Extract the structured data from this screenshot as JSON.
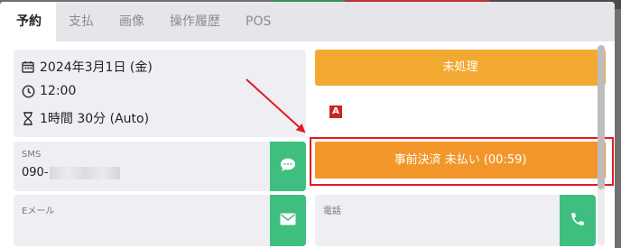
{
  "tabs": [
    {
      "label": "予約",
      "active": true
    },
    {
      "label": "支払"
    },
    {
      "label": "画像"
    },
    {
      "label": "操作履歴"
    },
    {
      "label": "POS"
    }
  ],
  "reservation": {
    "date": "2024年3月1日 (金)",
    "time": "12:00",
    "duration": "1時間 30分 (Auto)"
  },
  "sms": {
    "label": "SMS",
    "value": "090-"
  },
  "email": {
    "label": "Eメール"
  },
  "phone": {
    "label": "電話"
  },
  "status_button": {
    "label": "未処理",
    "color": "#f2a931"
  },
  "badge": {
    "letter": "A",
    "color": "#c62828"
  },
  "prepayment_button": {
    "label": "事前決済 未払い (00:59)",
    "color": "#f3962a"
  },
  "action_color": "#3fbf7f",
  "highlight_color": "#e11b22"
}
